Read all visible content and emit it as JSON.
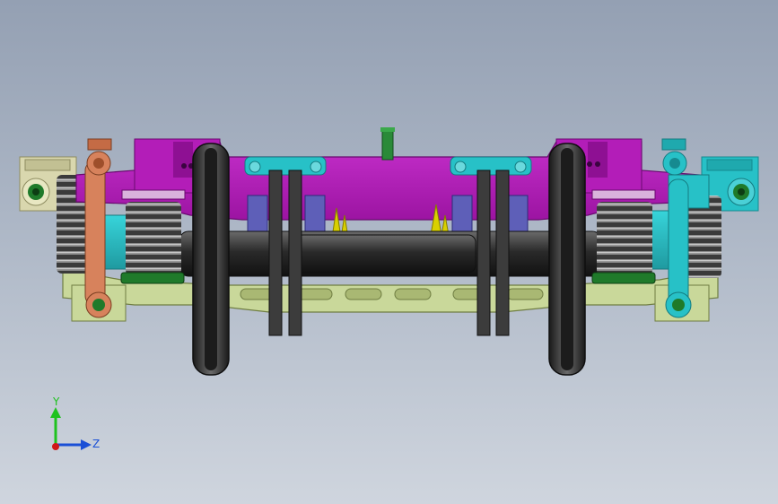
{
  "viewport": {
    "background_top": "#94a0b3",
    "background_bottom": "#cfd5de"
  },
  "colors": {
    "frame_magenta": "#b31db8",
    "frame_magenta_dark": "#7a0f80",
    "bracket_cyan": "#27c1c7",
    "bracket_cyan_dark": "#168a90",
    "plate_green": "#c9d89a",
    "plate_green_dark": "#8ea05a",
    "spring_grey": "#5a5a5a",
    "wheel_dark": "#2f2f2f",
    "hub_green": "#1f7a2a",
    "link_orange": "#d7825c",
    "tan_beige": "#d9d7ae",
    "yellow_part": "#d9d000",
    "blue_part": "#5e5fb8"
  },
  "triad": {
    "y_label": "Y",
    "z_label": "Z",
    "y_color": "#1ec21e",
    "z_color": "#1a4fd6",
    "origin_color": "#d01818"
  },
  "icons": {
    "triad": "axis-triad-icon"
  }
}
